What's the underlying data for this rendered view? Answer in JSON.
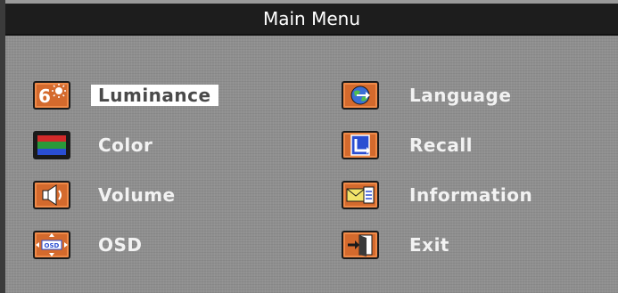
{
  "title": "Main Menu",
  "items_left": [
    {
      "label": "Luminance",
      "icon": "luminance-icon",
      "selected": true
    },
    {
      "label": "Color",
      "icon": "color-bars-icon",
      "selected": false
    },
    {
      "label": "Volume",
      "icon": "speaker-icon",
      "selected": false
    },
    {
      "label": "OSD",
      "icon": "osd-position-icon",
      "selected": false
    }
  ],
  "items_right": [
    {
      "label": "Language",
      "icon": "globe-icon",
      "selected": false
    },
    {
      "label": "Recall",
      "icon": "recall-icon",
      "selected": false
    },
    {
      "label": "Information",
      "icon": "envelope-info-icon",
      "selected": false
    },
    {
      "label": "Exit",
      "icon": "exit-door-icon",
      "selected": false
    }
  ],
  "colors": {
    "title_bar": "#1d1d1d",
    "menu_bg": "#8f8f8f",
    "icon_orange": "#d46a2d",
    "label_text": "#f2f2f2",
    "selected_bg": "#ffffff"
  }
}
